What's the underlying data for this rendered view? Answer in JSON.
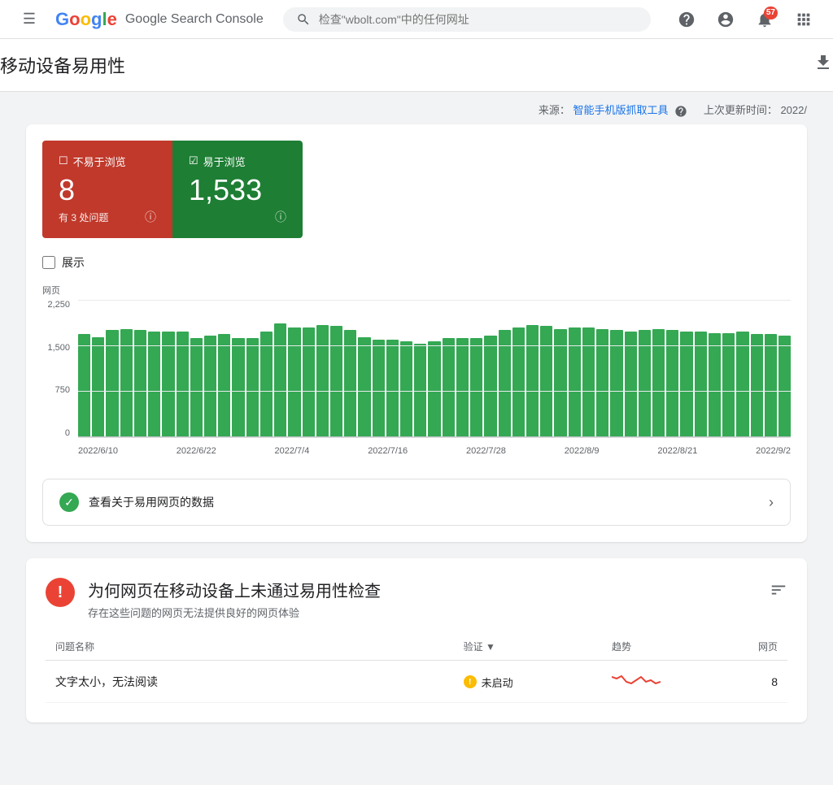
{
  "app": {
    "title": "Google Search Console",
    "logo_parts": [
      "G",
      "o",
      "o",
      "g",
      "l",
      "e"
    ],
    "search_placeholder": "检查\"wbolt.com\"中的任何网址"
  },
  "header": {
    "notification_count": "57"
  },
  "page": {
    "title": "移动设备易用性",
    "source_label": "来源：",
    "source_value": "智能手机版抓取工具",
    "last_updated_label": "上次更新时间：",
    "last_updated_value": "2022/"
  },
  "status": {
    "bad": {
      "label": "不易于浏览",
      "count": "8",
      "sub": "有 3 处问题"
    },
    "good": {
      "label": "易于浏览",
      "count": "1,533"
    }
  },
  "chart": {
    "y_label": "网页",
    "y_ticks": [
      "2,250",
      "1,500",
      "750",
      "0"
    ],
    "x_ticks": [
      "2022/6/10",
      "2022/6/22",
      "2022/7/4",
      "2022/7/16",
      "2022/7/28",
      "2022/8/9",
      "2022/8/21",
      "2022/9/2"
    ],
    "bars": [
      75,
      73,
      78,
      79,
      78,
      77,
      77,
      77,
      72,
      74,
      75,
      72,
      72,
      77,
      83,
      80,
      80,
      82,
      81,
      78,
      73,
      71,
      71,
      70,
      68,
      70,
      72,
      72,
      72,
      74,
      78,
      80,
      82,
      81,
      79,
      80,
      80,
      79,
      78,
      77,
      78,
      79,
      78,
      77,
      77,
      76,
      76,
      77,
      75,
      75,
      74
    ],
    "checkbox_label": "展示"
  },
  "easy_pages_link": {
    "text": "查看关于易用网页的数据"
  },
  "bottom_section": {
    "title": "为何网页在移动设备上未通过易用性检查",
    "subtitle": "存在这些问题的网页无法提供良好的网页体验",
    "table": {
      "col_name": "问题名称",
      "col_verify": "验证",
      "col_trend": "趋势",
      "col_pages": "网页",
      "rows": [
        {
          "name": "文字太小，无法阅读",
          "verify_status": "未启动",
          "pages": "8"
        }
      ]
    }
  }
}
